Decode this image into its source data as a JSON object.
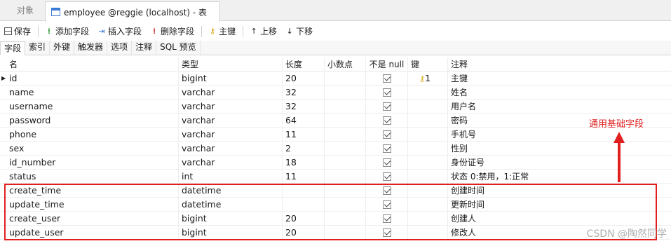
{
  "tabs": {
    "objects_label": "对象",
    "active_label": "employee @reggie (localhost) - 表"
  },
  "toolbar": {
    "save": "保存",
    "add_field": "添加字段",
    "insert_field": "插入字段",
    "delete_field": "删除字段",
    "primary_key": "主键",
    "move_up": "上移",
    "move_down": "下移"
  },
  "subtabs": [
    "字段",
    "索引",
    "外键",
    "触发器",
    "选项",
    "注释",
    "SQL 预览"
  ],
  "columns": {
    "name": "名",
    "type": "类型",
    "length": "长度",
    "decimal": "小数点",
    "not_null": "不是 null",
    "key": "键",
    "comment": "注释"
  },
  "rows": [
    {
      "name": "id",
      "type": "bigint",
      "length": "20",
      "decimal": "",
      "not_null": true,
      "key": "1",
      "comment": "主键"
    },
    {
      "name": "name",
      "type": "varchar",
      "length": "32",
      "decimal": "",
      "not_null": true,
      "key": "",
      "comment": "姓名"
    },
    {
      "name": "username",
      "type": "varchar",
      "length": "32",
      "decimal": "",
      "not_null": true,
      "key": "",
      "comment": "用户名"
    },
    {
      "name": "password",
      "type": "varchar",
      "length": "64",
      "decimal": "",
      "not_null": true,
      "key": "",
      "comment": "密码"
    },
    {
      "name": "phone",
      "type": "varchar",
      "length": "11",
      "decimal": "",
      "not_null": true,
      "key": "",
      "comment": "手机号"
    },
    {
      "name": "sex",
      "type": "varchar",
      "length": "2",
      "decimal": "",
      "not_null": true,
      "key": "",
      "comment": "性别"
    },
    {
      "name": "id_number",
      "type": "varchar",
      "length": "18",
      "decimal": "",
      "not_null": true,
      "key": "",
      "comment": "身份证号"
    },
    {
      "name": "status",
      "type": "int",
      "length": "11",
      "decimal": "",
      "not_null": true,
      "key": "",
      "comment": "状态 0:禁用，1:正常"
    },
    {
      "name": "create_time",
      "type": "datetime",
      "length": "",
      "decimal": "",
      "not_null": true,
      "key": "",
      "comment": "创建时间"
    },
    {
      "name": "update_time",
      "type": "datetime",
      "length": "",
      "decimal": "",
      "not_null": true,
      "key": "",
      "comment": "更新时间"
    },
    {
      "name": "create_user",
      "type": "bigint",
      "length": "20",
      "decimal": "",
      "not_null": true,
      "key": "",
      "comment": "创建人"
    },
    {
      "name": "update_user",
      "type": "bigint",
      "length": "20",
      "decimal": "",
      "not_null": true,
      "key": "",
      "comment": "修改人"
    }
  ],
  "annotation": {
    "label": "通用基础字段",
    "color": "#e02020"
  },
  "watermark": "CSDN @陶然同学",
  "icons": {
    "save": "save-icon",
    "add_field": "add-field-icon",
    "insert_field": "insert-field-icon",
    "delete_field": "delete-field-icon",
    "primary_key": "key-icon",
    "move_up": "arrow-up-icon",
    "move_down": "arrow-down-icon"
  }
}
